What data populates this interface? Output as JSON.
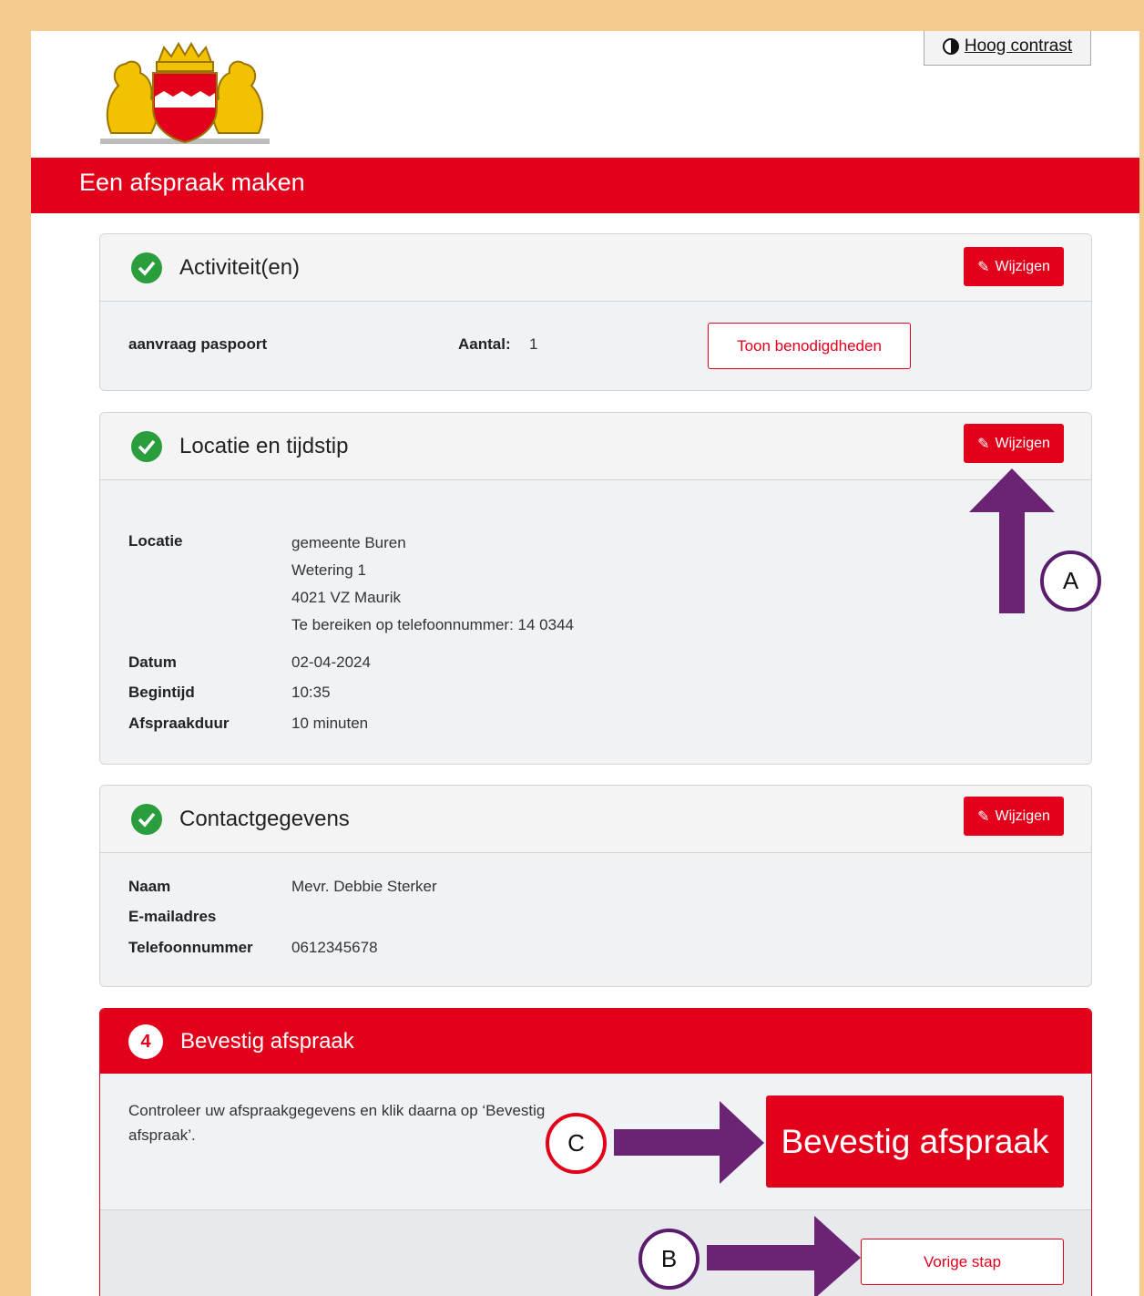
{
  "header": {
    "contrast_label": "Hoog contrast",
    "contrast_icon": "contrast-icon",
    "logo": "municipal-coat-of-arms"
  },
  "banner": {
    "title": "Een afspraak maken"
  },
  "colors": {
    "brand_red": "#e3001b",
    "success_green": "#2a9d3c",
    "annotation_purple": "#6b2473",
    "frame_orange": "#f6cb8f"
  },
  "activities": {
    "title": "Activiteit(en)",
    "edit_label": "Wijzigen",
    "item_name": "aanvraag paspoort",
    "count_label": "Aantal:",
    "count_value": "1",
    "requirements_button": "Toon benodigdheden"
  },
  "location": {
    "title": "Locatie en tijdstip",
    "edit_label": "Wijzigen",
    "location_label": "Locatie",
    "location_lines": [
      "gemeente Buren",
      "Wetering 1",
      "4021 VZ Maurik",
      "Te bereiken op telefoonnummer: 14 0344"
    ],
    "date_label": "Datum",
    "date_value": "02-04-2024",
    "start_label": "Begintijd",
    "start_value": "10:35",
    "duration_label": "Afspraakduur",
    "duration_value": "10 minuten"
  },
  "contact": {
    "title": "Contactgegevens",
    "edit_label": "Wijzigen",
    "name_label": "Naam",
    "name_value": "Mevr. Debbie Sterker",
    "email_label": "E-mailadres",
    "email_value": "",
    "phone_label": "Telefoonnummer",
    "phone_value": "0612345678"
  },
  "confirm": {
    "step_number": "4",
    "title": "Bevestig afspraak",
    "instruction": "Controleer uw afspraakgegevens en klik daarna op ‘Bevestig afspraak’.",
    "confirm_button": "Bevestig afspraak",
    "previous_button": "Vorige stap"
  },
  "annotations": {
    "a": "A",
    "b": "B",
    "c": "C"
  }
}
